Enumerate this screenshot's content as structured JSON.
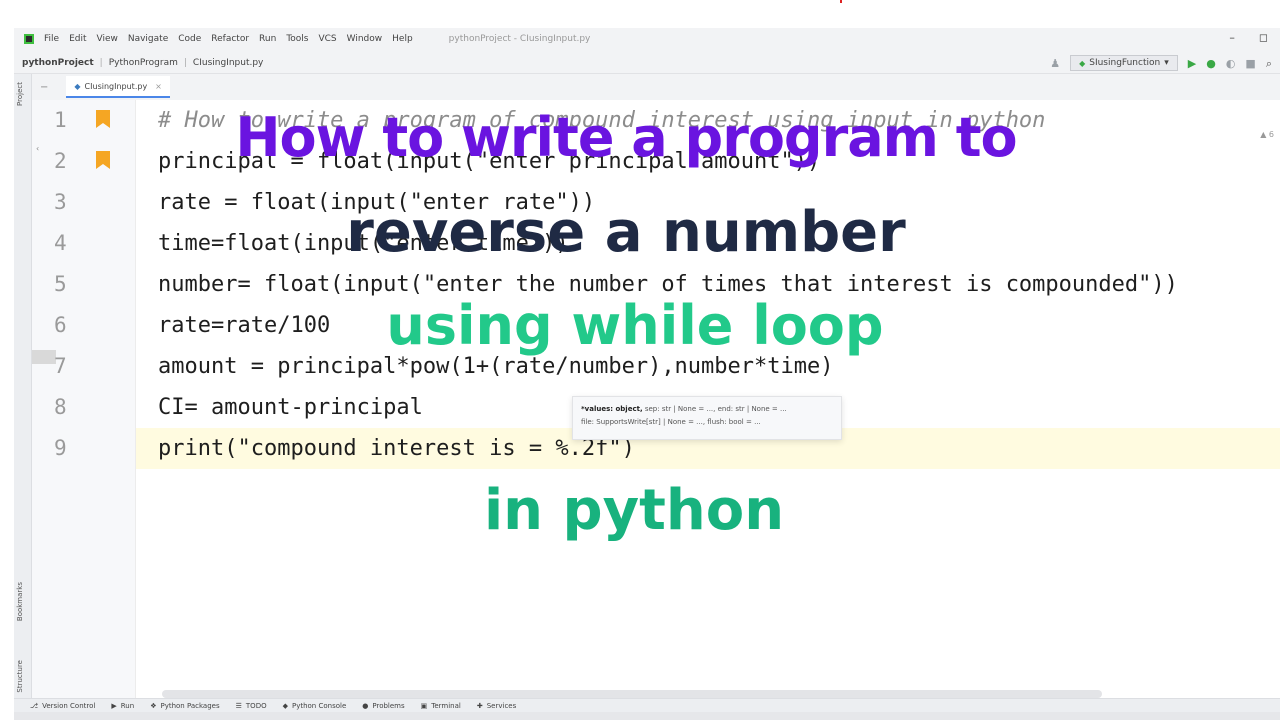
{
  "colors": {
    "overlay_line1": "#6a14e0",
    "overlay_line2": "#1f2a44",
    "overlay_line3": "#22c98a",
    "overlay_line4": "#18b27e",
    "bookmark": "#f5a623",
    "string": "#067d17",
    "builtin": "#0033b3"
  },
  "menubar": {
    "items": [
      "File",
      "Edit",
      "View",
      "Navigate",
      "Code",
      "Refactor",
      "Run",
      "Tools",
      "VCS",
      "Window",
      "Help"
    ],
    "window_title": "pythonProject - CIusingInput.py"
  },
  "navbar": {
    "project": "pythonProject",
    "folder": "PythonProgram",
    "file": "CIusingInput.py",
    "run_config": "SIusingFunction"
  },
  "left_strip": {
    "project": "Project",
    "bookmarks": "Bookmarks",
    "structure": "Structure"
  },
  "editor": {
    "tab_name": "CIusingInput.py",
    "inspection_count": "6",
    "lines": [
      {
        "num": "1",
        "text": "# How to write a program of compound interest using input in python"
      },
      {
        "num": "2",
        "text": "principal = float(input(\"enter principal amount\"))"
      },
      {
        "num": "3",
        "text": "rate = float(input(\"enter rate\"))"
      },
      {
        "num": "4",
        "text": "time=float(input(\"enter time\"))"
      },
      {
        "num": "5",
        "text": "number= float(input(\"enter the number of times that interest is compounded\"))"
      },
      {
        "num": "6",
        "text": "rate=rate/100"
      },
      {
        "num": "7",
        "text": "amount = principal*pow(1+(rate/number),number*time)"
      },
      {
        "num": "8",
        "text": "CI= amount-principal"
      },
      {
        "num": "9",
        "text": "print(\"compound interest is = %.2f\")"
      }
    ],
    "param_hint_line1_bold": "*values: object,",
    "param_hint_line1": " sep: str | None = ..., end: str | None = ...",
    "param_hint_line2": "file: SupportsWrite[str] | None = ..., flush: bool = ..."
  },
  "bottom_tools": [
    "Version Control",
    "Run",
    "Python Packages",
    "TODO",
    "Python Console",
    "Problems",
    "Terminal",
    "Services"
  ],
  "overlay": {
    "line1": "How to write a program to",
    "line2": "reverse a number",
    "line3": "using while loop",
    "line4": "in python"
  }
}
